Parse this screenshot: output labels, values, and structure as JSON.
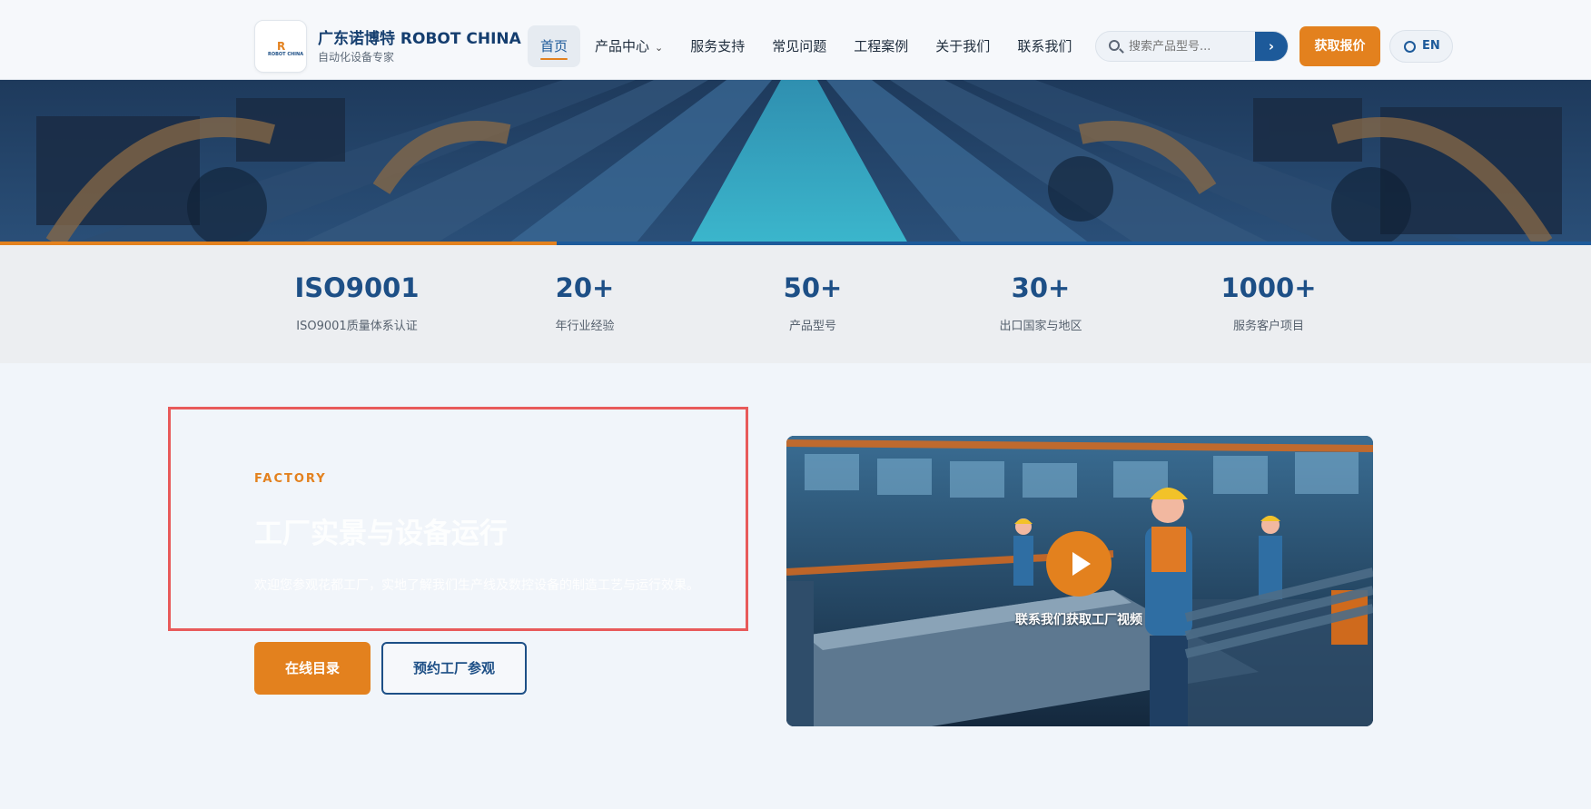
{
  "brand": {
    "logo_text": "R",
    "logo_subtext": "ROBOT CHINA",
    "title": "广东诺博特 ROBOT CHINA",
    "subtitle": "自动化设备专家"
  },
  "nav": {
    "items": [
      {
        "label": "首页",
        "active": true
      },
      {
        "label": "产品中心",
        "has_dropdown": true
      },
      {
        "label": "服务支持"
      },
      {
        "label": "常见问题"
      },
      {
        "label": "工程案例"
      },
      {
        "label": "关于我们"
      },
      {
        "label": "联系我们"
      }
    ]
  },
  "search": {
    "placeholder": "搜索产品型号...",
    "submit_icon": "chevron-right-icon"
  },
  "header_actions": {
    "quote_label": "获取报价",
    "lang_label": "EN",
    "lang_icon": "globe-icon"
  },
  "stats": [
    {
      "value": "ISO9001",
      "label": "ISO9001质量体系认证"
    },
    {
      "value": "20+",
      "label": "年行业经验"
    },
    {
      "value": "50+",
      "label": "产品型号"
    },
    {
      "value": "30+",
      "label": "出口国家与地区"
    },
    {
      "value": "1000+",
      "label": "服务客户项目"
    }
  ],
  "factory": {
    "kicker": "FACTORY",
    "title": "工厂实景与设备运行",
    "description": "欢迎您参观花都工厂，实地了解我们生产线及数控设备的制造工艺与运行效果。",
    "primary_button": "在线目录",
    "secondary_button": "预约工厂参观",
    "video_caption": "联系我们获取工厂视频"
  },
  "colors": {
    "accent": "#e3811e",
    "primary": "#1d5a9a",
    "dark_blue": "#153e6f",
    "selection_border": "#e85a5a",
    "page_bg": "#f1f5fa"
  }
}
